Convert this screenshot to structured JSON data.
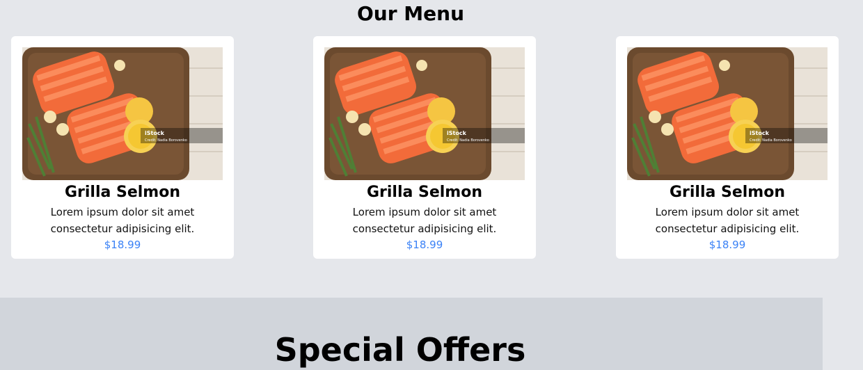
{
  "menu": {
    "title": "Our Menu",
    "cards": [
      {
        "image_alt": "Grilled salmon fillets with lemon, garlic and rosemary on a wooden board",
        "watermark_brand": "iStock",
        "watermark_credit": "Credit: Nadia Borovenko",
        "title": "Grilla Selmon",
        "description": "Lorem ipsum dolor sit amet consectetur adipisicing elit.",
        "price": "$18.99"
      },
      {
        "image_alt": "Grilled salmon fillets with lemon, garlic and rosemary on a wooden board",
        "watermark_brand": "iStock",
        "watermark_credit": "Credit: Nadia Borovenko",
        "title": "Grilla Selmon",
        "description": "Lorem ipsum dolor sit amet consectetur adipisicing elit.",
        "price": "$18.99"
      },
      {
        "image_alt": "Grilled salmon fillets with lemon, garlic and rosemary on a wooden board",
        "watermark_brand": "iStock",
        "watermark_credit": "Credit: Nadia Borovenko",
        "title": "Grilla Selmon",
        "description": "Lorem ipsum dolor sit amet consectetur adipisicing elit.",
        "price": "$18.99"
      }
    ]
  },
  "offers": {
    "title": "Special Offers"
  },
  "colors": {
    "page_background": "#e5e7eb",
    "card_background": "#ffffff",
    "offers_background": "#d1d5db",
    "price": "#3b82f6"
  }
}
